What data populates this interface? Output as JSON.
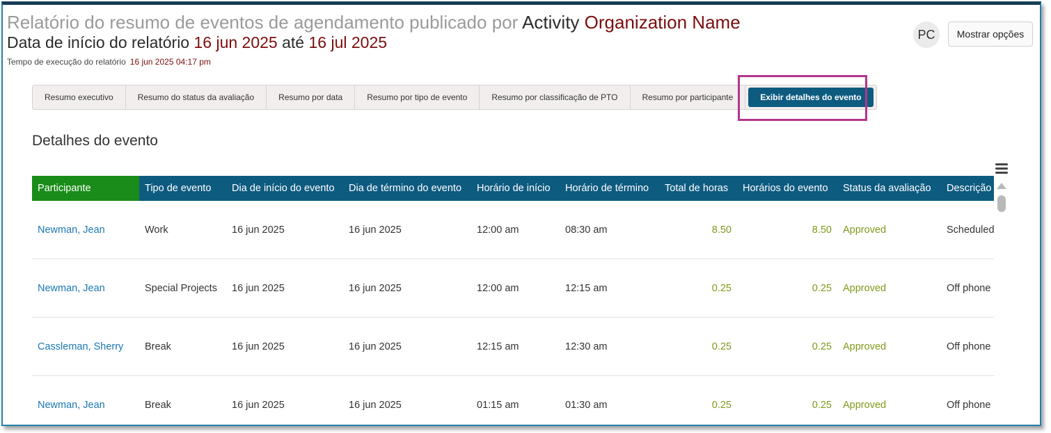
{
  "header": {
    "title_prefix": "Relatório do resumo de eventos de agendamento publicado por",
    "title_activity": "Activity",
    "title_org": "Organization Name",
    "date_label": "Data de início do relatório",
    "date_start": "16 jun 2025",
    "date_between": "até",
    "date_end": "16 jul 2025",
    "exec_label": "Tempo de execução do relatório",
    "exec_value": "16 jun 2025 04:17 pm",
    "avatar_initials": "PC",
    "options_label": "Mostrar opções"
  },
  "tabs": [
    {
      "label": "Resumo executivo"
    },
    {
      "label": "Resumo do status da avaliação"
    },
    {
      "label": "Resumo por data"
    },
    {
      "label": "Resumo por tipo de evento"
    },
    {
      "label": "Resumo por classificação de PTO"
    },
    {
      "label": "Resumo por participante"
    },
    {
      "label": "Exibir detalhes do evento",
      "active": true
    }
  ],
  "section_title": "Detalhes do evento",
  "table": {
    "columns": [
      "Participante",
      "Tipo de evento",
      "Dia de início do evento",
      "Dia de término do evento",
      "Horário de início",
      "Horário de término",
      "Total de horas",
      "Horários do evento",
      "Status da avaliação",
      "Descrição"
    ],
    "rows": [
      [
        "Newman, Jean",
        "Work",
        "16 jun 2025",
        "16 jun 2025",
        "12:00 am",
        "08:30 am",
        "8.50",
        "8.50",
        "Approved",
        "Scheduled"
      ],
      [
        "Newman, Jean",
        "Special Projects",
        "16 jun 2025",
        "16 jun 2025",
        "12:00 am",
        "12:15 am",
        "0.25",
        "0.25",
        "Approved",
        "Off phone"
      ],
      [
        "Cassleman, Sherry",
        "Break",
        "16 jun 2025",
        "16 jun 2025",
        "12:15 am",
        "12:30 am",
        "0.25",
        "0.25",
        "Approved",
        "Off phone"
      ],
      [
        "Newman, Jean",
        "Break",
        "16 jun 2025",
        "16 jun 2025",
        "01:15 am",
        "01:30 am",
        "0.25",
        "0.25",
        "Approved",
        "Off phone"
      ]
    ]
  },
  "colors": {
    "header_blue": "#0e5b80",
    "header_green": "#198c19",
    "accent_red": "#7a0e0e",
    "highlight": "#b3368c",
    "link": "#1b78b4",
    "value_green": "#7f9a1a"
  },
  "icons": {
    "menu": "hamburger-menu-icon",
    "scroll_up": "scroll-up-arrow-icon"
  }
}
